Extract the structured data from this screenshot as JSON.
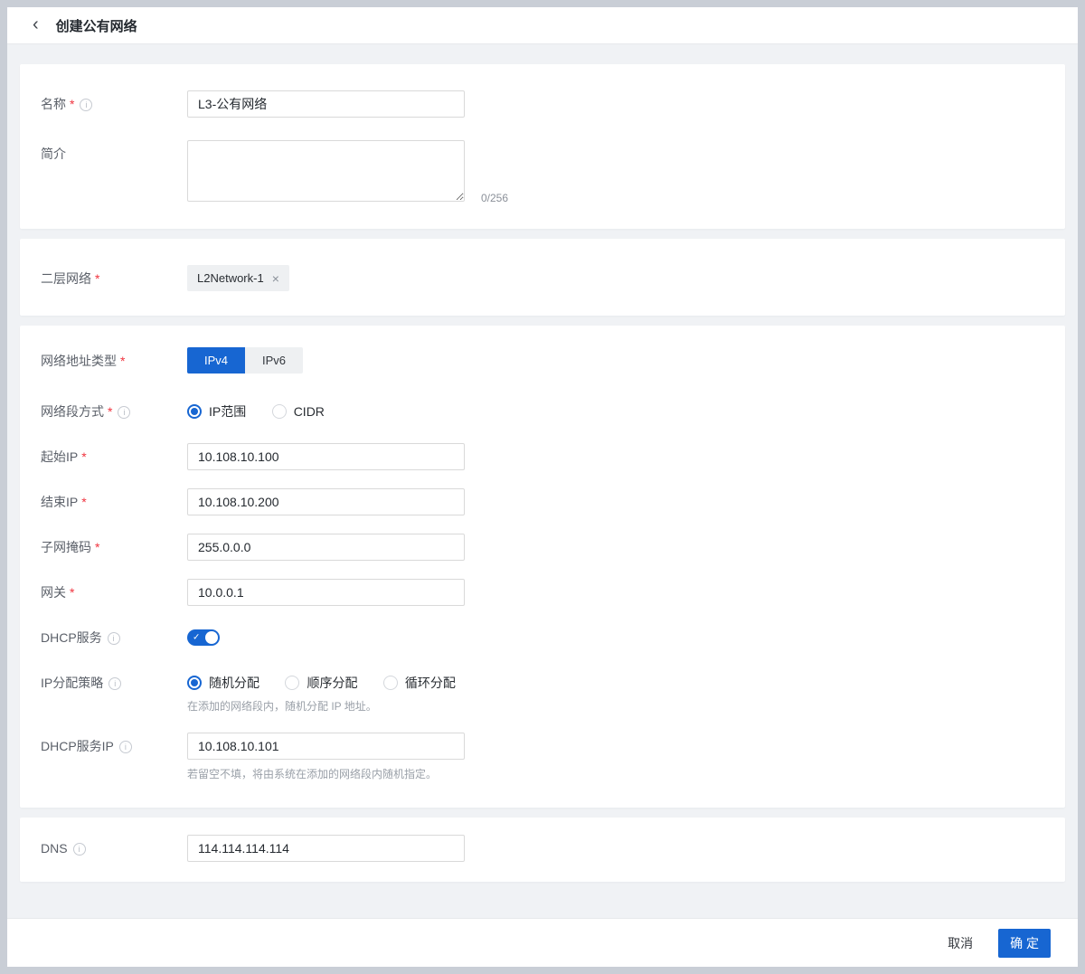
{
  "ui": {
    "required_marker": "*",
    "info_glyph": "i",
    "back_icon": "‹",
    "remove_icon": "×",
    "check_icon": "✓"
  },
  "colors": {
    "primary": "#1766D2",
    "background": "#F0F2F5",
    "card": "#FFFFFF",
    "required_red": "#F0343F",
    "input_border": "#D9D9D9",
    "muted_text": "#9AA0A8"
  },
  "header": {
    "title": "创建公有网络"
  },
  "form": {
    "name": {
      "label": "名称",
      "value": "L3-公有网络"
    },
    "description": {
      "label": "简介",
      "value": "",
      "counter": "0/256"
    },
    "l2_network": {
      "label": "二层网络",
      "tag": "L2Network-1"
    },
    "ip_version": {
      "label": "网络地址类型",
      "options": [
        "IPv4",
        "IPv6"
      ],
      "selected": "IPv4"
    },
    "segment_mode": {
      "label": "网络段方式",
      "options": [
        "IP范围",
        "CIDR"
      ],
      "selected": "IP范围"
    },
    "start_ip": {
      "label": "起始IP",
      "value": "10.108.10.100"
    },
    "end_ip": {
      "label": "结束IP",
      "value": "10.108.10.200"
    },
    "netmask": {
      "label": "子网掩码",
      "value": "255.0.0.0"
    },
    "gateway": {
      "label": "网关",
      "value": "10.0.0.1"
    },
    "dhcp_service": {
      "label": "DHCP服务",
      "enabled": true
    },
    "alloc_strategy": {
      "label": "IP分配策略",
      "options": [
        "随机分配",
        "顺序分配",
        "循环分配"
      ],
      "selected": "随机分配",
      "helper": "在添加的网络段内，随机分配 IP 地址。"
    },
    "dhcp_server_ip": {
      "label": "DHCP服务IP",
      "value": "10.108.10.101",
      "helper": "若留空不填，将由系统在添加的网络段内随机指定。"
    },
    "dns": {
      "label": "DNS",
      "value": "114.114.114.114"
    }
  },
  "footer": {
    "cancel": "取消",
    "confirm": "确 定"
  }
}
